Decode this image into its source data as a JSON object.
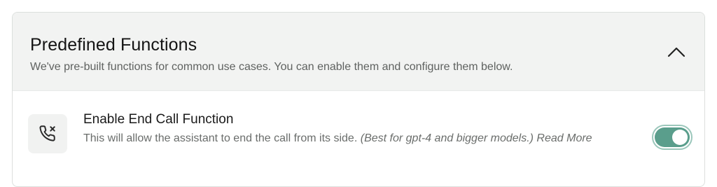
{
  "section": {
    "title": "Predefined Functions",
    "description": "We've pre-built functions for common use cases. You can enable them and configure them below.",
    "expanded": true,
    "collapse_icon": "chevron-up-icon"
  },
  "functions": [
    {
      "icon": "phone-x-icon",
      "title": "Enable End Call Function",
      "description": "This will allow the assistant to end the call from its side.",
      "note": "(Best for gpt-4 and bigger models.)",
      "read_more": "Read More",
      "enabled": true
    }
  ],
  "colors": {
    "toggle_on": "#5a9e8c",
    "header_bg": "#f2f3f2"
  }
}
